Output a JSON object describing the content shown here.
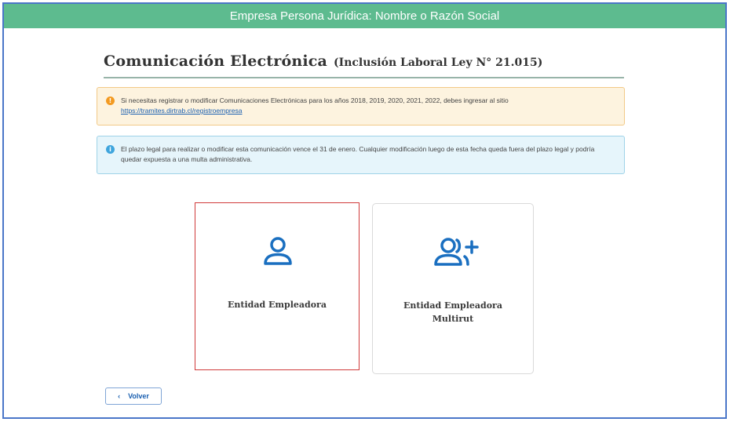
{
  "header": {
    "title": "Empresa Persona Jurídica: Nombre o Razón Social"
  },
  "page": {
    "title": "Comunicación Electrónica",
    "subtitle": "(Inclusión Laboral Ley N° 21.015)"
  },
  "alerts": {
    "warning": {
      "icon": "exclamation-icon",
      "text": "Si necesitas registrar o modificar Comunicaciones Electrónicas para los años 2018, 2019, 2020, 2021, 2022, debes ingresar al sitio",
      "link": "https://tramites.dirtrab.cl/registroempresa"
    },
    "info": {
      "icon": "info-icon",
      "text": "El plazo legal para realizar o modificar esta comunicación vence el 31 de enero. Cualquier modificación luego de esta fecha queda fuera del plazo legal y podría quedar expuesta a una multa administrativa."
    }
  },
  "options": [
    {
      "label": "Entidad Empleadora",
      "icon": "user-icon",
      "selected": true
    },
    {
      "label": "Entidad Empleadora Multirut",
      "icon": "users-plus-icon",
      "selected": false
    }
  ],
  "actions": {
    "back_icon": "‹",
    "back_label": "Volver"
  },
  "colors": {
    "header_bg": "#5dbb8f",
    "accent_blue": "#1a6fc0",
    "selected_border": "#d03a3a",
    "warning_bg": "#fdf3df",
    "info_bg": "#e6f5fb"
  }
}
